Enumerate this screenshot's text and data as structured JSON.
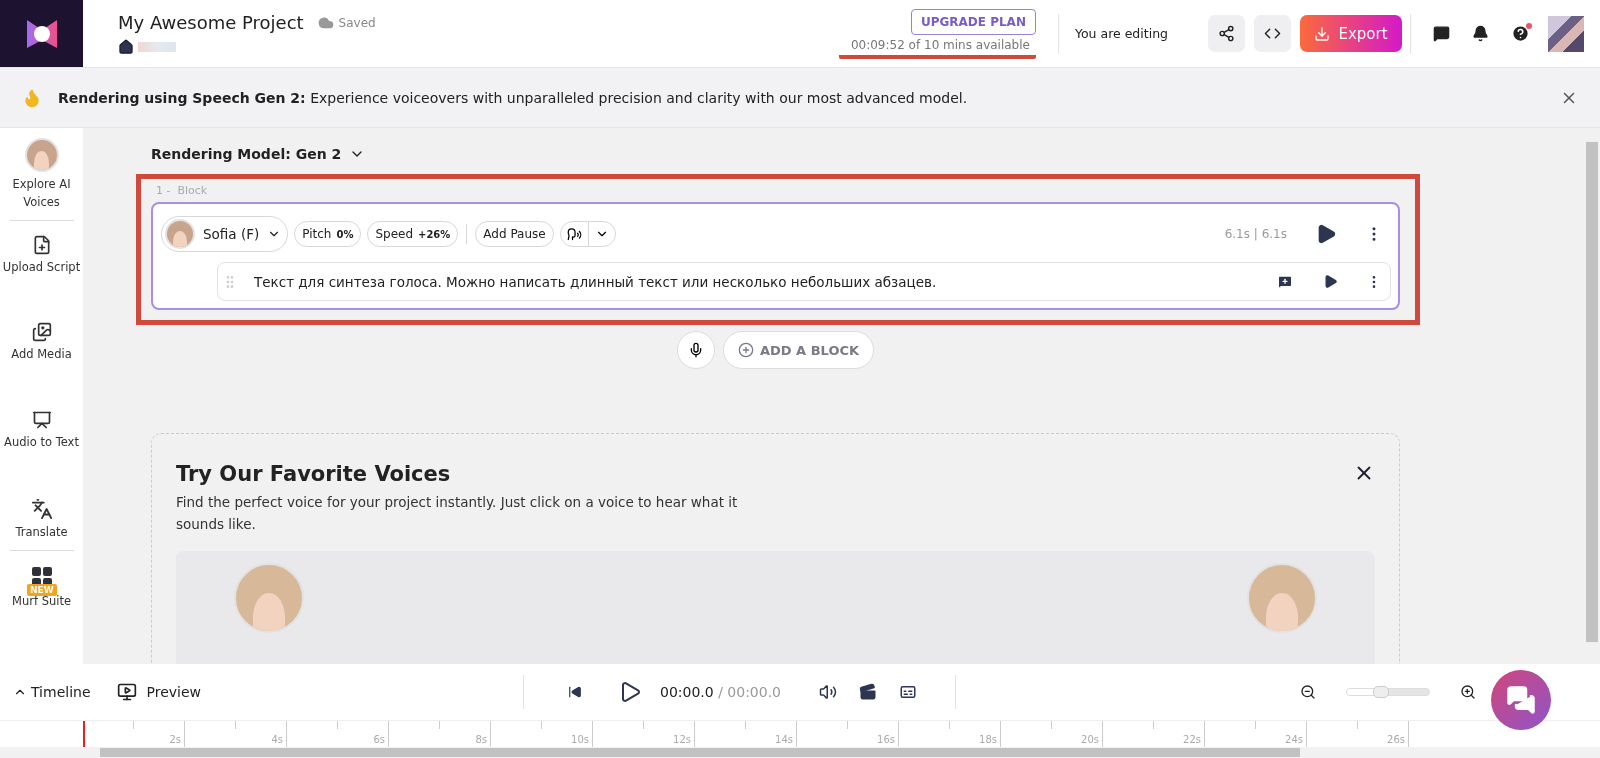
{
  "header": {
    "project_title": "My Awesome Project",
    "save_status": "Saved",
    "upgrade_button": "UPGRADE PLAN",
    "usage": "00:09:52 of 10 mins available",
    "usage_marked": true,
    "editing_status": "You are editing",
    "export_button": "Export",
    "help_notification": true
  },
  "banner": {
    "text": "**Rendering using Speech Gen 2:** Experience voiceovers with unparalleled precision and clarity with our most advanced model."
  },
  "sidebar": {
    "items": [
      {
        "label": "Explore AI Voices",
        "kind": "avatar",
        "divider_after": true
      },
      {
        "label": "Upload Script",
        "kind": "upload",
        "divider_after": false
      },
      {
        "label": "Add Media",
        "kind": "media",
        "divider_after": false
      },
      {
        "label": "Audio to Text",
        "kind": "transcribe",
        "divider_after": false
      },
      {
        "label": "Translate",
        "kind": "translate",
        "divider_after": true
      },
      {
        "label": "Murf Suite",
        "kind": "suite",
        "divider_after": false,
        "badge": "NEW"
      }
    ]
  },
  "editor": {
    "model_selector": "Rendering Model: Gen 2",
    "blocks": [
      {
        "number": "1 -",
        "label": "Block",
        "marked": true,
        "voice": "Sofia (F)",
        "pitch_label": "Pitch",
        "pitch": "0%",
        "speed_label": "Speed",
        "speed": "+26%",
        "pause_button": "Add Pause",
        "duration": "6.1s | 6.1s",
        "paragraphs": [
          {
            "text": "Текст для синтеза голоса. Можно написать длинный текст или несколько небольших абзацев."
          }
        ]
      }
    ],
    "add_block_button": "ADD A BLOCK"
  },
  "favorite_voices": {
    "title": "Try Our Favorite Voices",
    "description": "Find the perfect voice for your project instantly. Just click on a voice to hear what it sounds like.",
    "voices": [
      {
        "kind": "avatar"
      },
      {
        "kind": "avatar"
      }
    ]
  },
  "player": {
    "timeline_toggle": "Timeline",
    "preview_button": "Preview",
    "current_time": "00:00.0",
    "total_time": "/ 00:00.0",
    "zoom": {
      "level": 0.42
    }
  },
  "ruler": {
    "labels": [
      "2s",
      "4s",
      "6s",
      "8s",
      "10s",
      "12s",
      "14s",
      "16s",
      "18s",
      "20s",
      "22s",
      "24s",
      "26s"
    ]
  }
}
